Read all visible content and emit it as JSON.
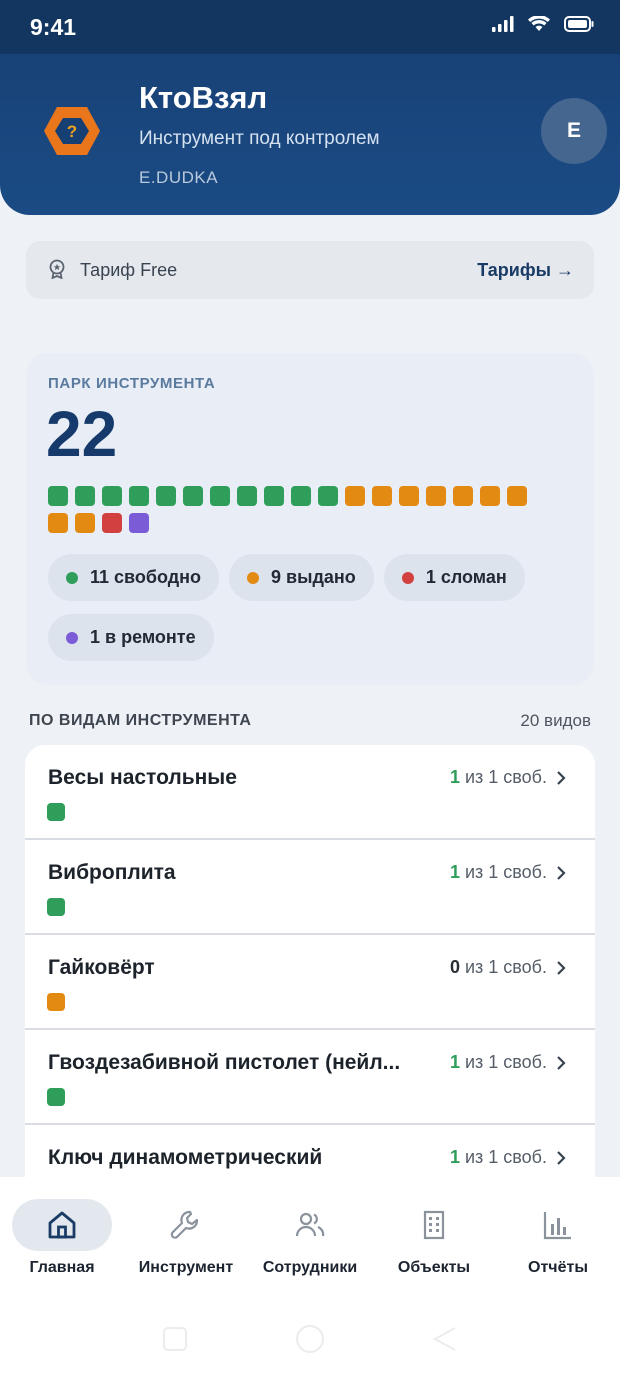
{
  "status_bar": {
    "time": "9:41"
  },
  "header": {
    "title": "КтоВзял",
    "subtitle": "Инструмент под контролем",
    "user": "E.DUDKA",
    "avatar_letter": "E"
  },
  "tariff": {
    "label": "Тариф Free",
    "link": "Тарифы →"
  },
  "fleet": {
    "title": "ПАРК ИНСТРУМЕНТА",
    "total": "22",
    "squares": [
      "green",
      "green",
      "green",
      "green",
      "green",
      "green",
      "green",
      "green",
      "green",
      "green",
      "green",
      "orange",
      "orange",
      "orange",
      "orange",
      "orange",
      "orange",
      "orange",
      "orange",
      "orange",
      "red",
      "purple"
    ],
    "stats": [
      {
        "label": "11 свободно",
        "color": "#2f9e5b"
      },
      {
        "label": "9 выдано",
        "color": "#e38a12"
      },
      {
        "label": "1 сломан",
        "color": "#d24040"
      },
      {
        "label": "1 в ремонте",
        "color": "#7b5bd6"
      }
    ]
  },
  "colors": {
    "green": "#2f9e5b",
    "orange": "#e38a12",
    "red": "#d24040",
    "purple": "#7b5bd6"
  },
  "section": {
    "title": "ПО ВИДАМ ИНСТРУМЕНТА",
    "count": "20 видов"
  },
  "tools": [
    {
      "name": "Весы настольные",
      "free": "1",
      "total_text": " из 1 своб.",
      "status": "green"
    },
    {
      "name": "Виброплита",
      "free": "1",
      "total_text": " из 1 своб.",
      "status": "green"
    },
    {
      "name": "Гайковёрт",
      "free": "0",
      "total_text": " из 1 своб.",
      "status": "orange"
    },
    {
      "name": "Гвоздезабивной пистолет (нейл...",
      "free": "1",
      "total_text": " из 1 своб.",
      "status": "green"
    },
    {
      "name": "Ключ динамометрический",
      "free": "1",
      "total_text": " из 1 своб.",
      "status": "green"
    }
  ],
  "nav": [
    {
      "label": "Главная",
      "icon": "home-icon"
    },
    {
      "label": "Инструмент",
      "icon": "wrench-icon"
    },
    {
      "label": "Сотрудники",
      "icon": "users-icon"
    },
    {
      "label": "Объекты",
      "icon": "building-icon"
    },
    {
      "label": "Отчёты",
      "icon": "chart-icon"
    }
  ]
}
